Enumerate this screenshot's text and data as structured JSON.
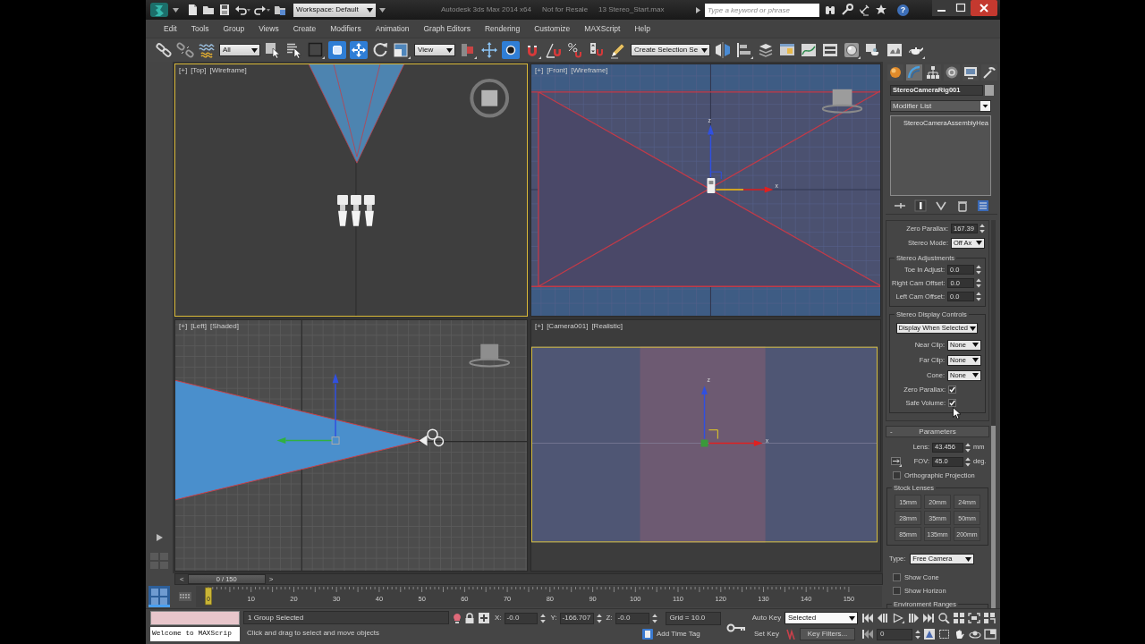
{
  "title_bar": {
    "workspace": "Workspace: Default",
    "title_parts": [
      "Autodesk 3ds Max 2014 x64",
      "Not for Resale",
      "13 Stereo_Start.max"
    ],
    "search": {
      "placeholder": "Type a keyword or phrase"
    },
    "help": "?"
  },
  "menu_bar": [
    "Edit",
    "Tools",
    "Group",
    "Views",
    "Create",
    "Modifiers",
    "Animation",
    "Graph Editors",
    "Rendering",
    "Customize",
    "MAXScript",
    "Help"
  ],
  "toolbar": [
    {
      "kind": "tool",
      "selected": false
    },
    {
      "kind": "tool",
      "selected": false
    },
    {
      "kind": "tool",
      "selected": false
    },
    {
      "kind": "dropdown",
      "value": "All"
    },
    {
      "kind": "tool",
      "selected": false
    },
    {
      "kind": "tool",
      "selected": false
    },
    {
      "kind": "tool",
      "selected": false
    },
    {
      "kind": "tool",
      "selected": true
    },
    {
      "kind": "tool",
      "selected": true
    },
    {
      "kind": "tool",
      "selected": false
    },
    {
      "kind": "tool",
      "selected": false
    },
    {
      "kind": "dropdown",
      "value": "View"
    },
    {
      "kind": "tool",
      "selected": false
    },
    {
      "kind": "tool",
      "selected": false
    },
    {
      "kind": "tool",
      "selected": true
    },
    {
      "kind": "tool",
      "selected": false
    },
    {
      "kind": "tool",
      "selected": false
    },
    {
      "kind": "tool",
      "selected": false
    },
    {
      "kind": "tool",
      "selected": false
    },
    {
      "kind": "tool",
      "selected": false
    },
    {
      "kind": "dropdown",
      "value": "Create Selection Se"
    },
    {
      "kind": "tool",
      "selected": false
    },
    {
      "kind": "tool",
      "selected": false
    },
    {
      "kind": "tool",
      "selected": false
    },
    {
      "kind": "tool",
      "selected": false
    },
    {
      "kind": "tool",
      "selected": false
    },
    {
      "kind": "tool",
      "selected": false
    },
    {
      "kind": "tool",
      "selected": false
    },
    {
      "kind": "tool",
      "selected": false
    },
    {
      "kind": "tool",
      "selected": false
    },
    {
      "kind": "tool",
      "selected": false
    }
  ],
  "viewports": [
    {
      "kind": "top",
      "active": true,
      "labels": [
        "[+]",
        "[Top]",
        "[Wireframe]"
      ]
    },
    {
      "kind": "front",
      "active": false,
      "labels": [
        "[+]",
        "[Front]",
        "[Wireframe]"
      ],
      "gizmo": {
        "z_label": "z",
        "x_label": "x"
      }
    },
    {
      "kind": "left",
      "active": false,
      "labels": [
        "[+]",
        "[Left]",
        "[Shaded]"
      ]
    },
    {
      "kind": "camera",
      "active": false,
      "labels": [
        "[+]",
        "[Camera001]",
        "[Realistic]"
      ],
      "gizmo": {
        "z_label": "z",
        "x_label": "x"
      }
    }
  ],
  "command_panel": {
    "tabs": [
      {
        "selected": false
      },
      {
        "selected": true
      },
      {
        "selected": false
      },
      {
        "selected": false
      },
      {
        "selected": false
      },
      {
        "selected": false
      }
    ],
    "object_name": "StereoCameraRig001",
    "modifier_list": "Modifier List",
    "stack": [
      {
        "label": "StereoCameraAssemblyHea",
        "selected": false
      }
    ],
    "stereo_rows": [
      {
        "kind": "spinner",
        "label": "Zero Parallax:",
        "value": "167.39"
      },
      {
        "kind": "dropdown",
        "label": "Stereo Mode:",
        "value": "Off Ax"
      },
      {
        "kind": "group",
        "title": "Stereo Adjustments",
        "rows": [
          {
            "kind": "spinner",
            "label": "Toe In Adjust:",
            "value": "0.0"
          },
          {
            "kind": "spinner",
            "label": "Right Cam Offset:",
            "value": "0.0"
          },
          {
            "kind": "spinner",
            "label": "Left Cam Offset:",
            "value": "0.0"
          }
        ]
      },
      {
        "kind": "group",
        "title": "Stereo Display Controls",
        "rows": [
          {
            "kind": "dropdown",
            "value": "Display When Selected"
          },
          {
            "kind": "dropdown",
            "label": "Near Clip:",
            "value": "None"
          },
          {
            "kind": "dropdown",
            "label": "Far Clip:",
            "value": "None"
          },
          {
            "kind": "dropdown",
            "label": "Cone:",
            "value": "None"
          },
          {
            "kind": "check",
            "label": "Zero Parallax:",
            "checked": true
          },
          {
            "kind": "check",
            "label": "Safe Volume:",
            "checked": true
          }
        ]
      }
    ],
    "parameters": {
      "toggle": "-",
      "title": "Parameters",
      "rows": [
        {
          "kind": "spinner",
          "label": "Lens:",
          "value": "43.456",
          "unit": "mm"
        },
        {
          "kind": "spinner",
          "label": "FOV:",
          "value": "45.0",
          "unit": "deg.",
          "flyout": true
        },
        {
          "kind": "checkbox",
          "label": "Orthographic Projection",
          "checked": false
        },
        {
          "kind": "group",
          "title": "Stock Lenses",
          "buttons": [
            "15mm",
            "20mm",
            "24mm",
            "28mm",
            "35mm",
            "50mm",
            "85mm",
            "135mm",
            "200mm"
          ]
        },
        {
          "kind": "dropdown",
          "label": "Type:",
          "value": "Free Camera"
        },
        {
          "kind": "checkbox",
          "label": "Show Cone",
          "checked": false
        },
        {
          "kind": "checkbox",
          "label": "Show Horizon",
          "checked": false
        },
        {
          "kind": "group",
          "title": "Environment Ranges"
        }
      ]
    }
  },
  "time_slider": {
    "prev": "<",
    "frame": "0 / 150",
    "next": ">",
    "level": 0
  },
  "track_bar": {
    "current": "0",
    "ticks": [
      "10",
      "20",
      "30",
      "40",
      "50",
      "60",
      "70",
      "80",
      "90",
      "100",
      "110",
      "120",
      "130",
      "140",
      "150"
    ]
  },
  "status_bar": {
    "listener_output": "Welcome to MAXScrip",
    "selection": "1 Group Selected",
    "prompt": "Click and drag to select and move objects",
    "coords": [
      {
        "axis": "X:",
        "value": "-0.0"
      },
      {
        "axis": "Y:",
        "value": "-166.707"
      },
      {
        "axis": "Z:",
        "value": "-0.0"
      }
    ],
    "grid": "Grid = 10.0",
    "add_time_tag": "Add Time Tag",
    "auto_key": "Auto Key",
    "key_mode": "Selected",
    "set_key": "Set Key",
    "key_filters": "Key Filters...",
    "current_frame": "0"
  }
}
